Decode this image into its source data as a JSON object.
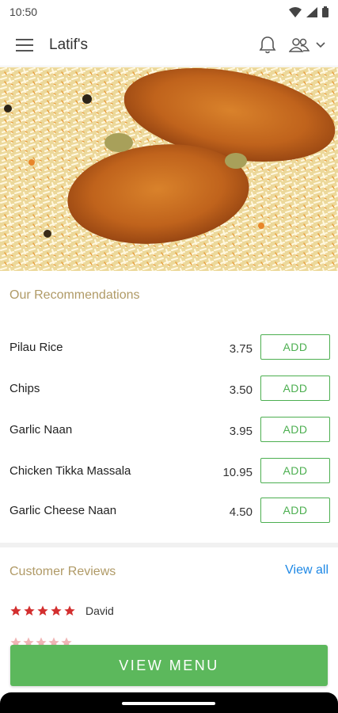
{
  "status_bar": {
    "time": "10:50"
  },
  "app_bar": {
    "title": "Latif's"
  },
  "recommendations": {
    "title": "Our Recommendations",
    "items": [
      {
        "name": "Pilau Rice",
        "price": "3.75",
        "action": "ADD"
      },
      {
        "name": "Chips",
        "price": "3.50",
        "action": "ADD"
      },
      {
        "name": "Garlic Naan",
        "price": "3.95",
        "action": "ADD"
      },
      {
        "name": "Chicken Tikka Massala",
        "price": "10.95",
        "action": "ADD"
      },
      {
        "name": "Garlic Cheese Naan",
        "price": "4.50",
        "action": "ADD"
      }
    ]
  },
  "reviews": {
    "title": "Customer Reviews",
    "view_all": "View all",
    "items": [
      {
        "name": "David",
        "stars": 5
      }
    ]
  },
  "cta": {
    "label": "VIEW MENU"
  },
  "colors": {
    "accent_green": "#5cb85c",
    "link_blue": "#1e88e5",
    "section_gold": "#b09a66",
    "star_red": "#d32f2f"
  }
}
